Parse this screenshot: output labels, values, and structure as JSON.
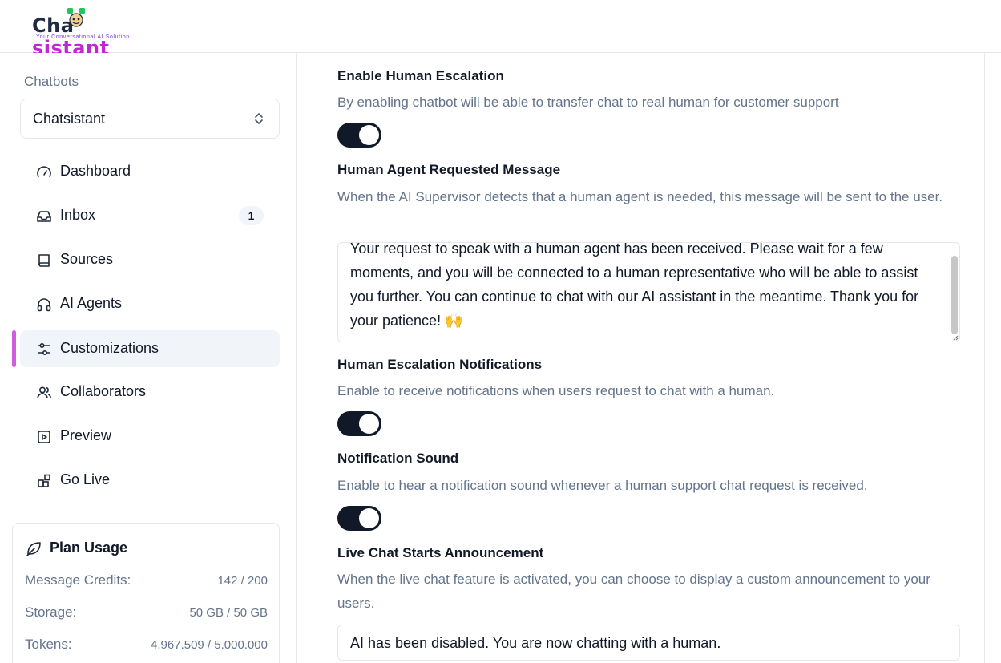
{
  "brand": {
    "name_part1": "Cha",
    "name_part2": "sistant",
    "tagline": "Your Conversational AI Solution"
  },
  "sidebar": {
    "chatbots_label": "Chatbots",
    "selected_chatbot": "Chatsistant",
    "items": [
      {
        "label": "Dashboard",
        "icon": "gauge-icon"
      },
      {
        "label": "Inbox",
        "icon": "inbox-icon",
        "badge": "1"
      },
      {
        "label": "Sources",
        "icon": "book-icon"
      },
      {
        "label": "AI Agents",
        "icon": "headphones-icon"
      },
      {
        "label": "Customizations",
        "icon": "sliders-icon",
        "active": true
      },
      {
        "label": "Collaborators",
        "icon": "users-icon"
      },
      {
        "label": "Preview",
        "icon": "play-square-icon"
      },
      {
        "label": "Go Live",
        "icon": "blocks-icon"
      }
    ],
    "plan": {
      "title": "Plan Usage",
      "rows": [
        {
          "label": "Message Credits:",
          "value": "142 / 200"
        },
        {
          "label": "Storage:",
          "value": "50 GB / 50 GB"
        },
        {
          "label": "Tokens:",
          "value": "4.967.509 / 5.000.000"
        }
      ]
    }
  },
  "settings": {
    "human_escalation": {
      "title": "Enable Human Escalation",
      "description": "By enabling chatbot will be able to transfer chat to real human for customer support",
      "enabled": true
    },
    "agent_requested_message": {
      "title": "Human Agent Requested Message",
      "description": "When the AI Supervisor detects that a human agent is needed, this message will be sent to the user.",
      "value": "Your request to speak with a human agent has been received. Please wait for a few moments, and you will be connected to a human representative who will be able to assist you further. You can continue to chat with our AI assistant in the meantime. Thank you for your patience! 🙌"
    },
    "escalation_notifications": {
      "title": "Human Escalation Notifications",
      "description": "Enable to receive notifications when users request to chat with a human.",
      "enabled": true
    },
    "notification_sound": {
      "title": "Notification Sound",
      "description": "Enable to hear a notification sound whenever a human support chat request is received.",
      "enabled": true
    },
    "live_chat_announcement": {
      "title": "Live Chat Starts Announcement",
      "description": "When the live chat feature is activated, you can choose to display a custom announcement to your users.",
      "value": "AI has been disabled. You are now chatting with a human."
    }
  },
  "colors": {
    "accent": "#c026d3",
    "toggle_on": "#111827",
    "muted_text": "#64748b"
  }
}
